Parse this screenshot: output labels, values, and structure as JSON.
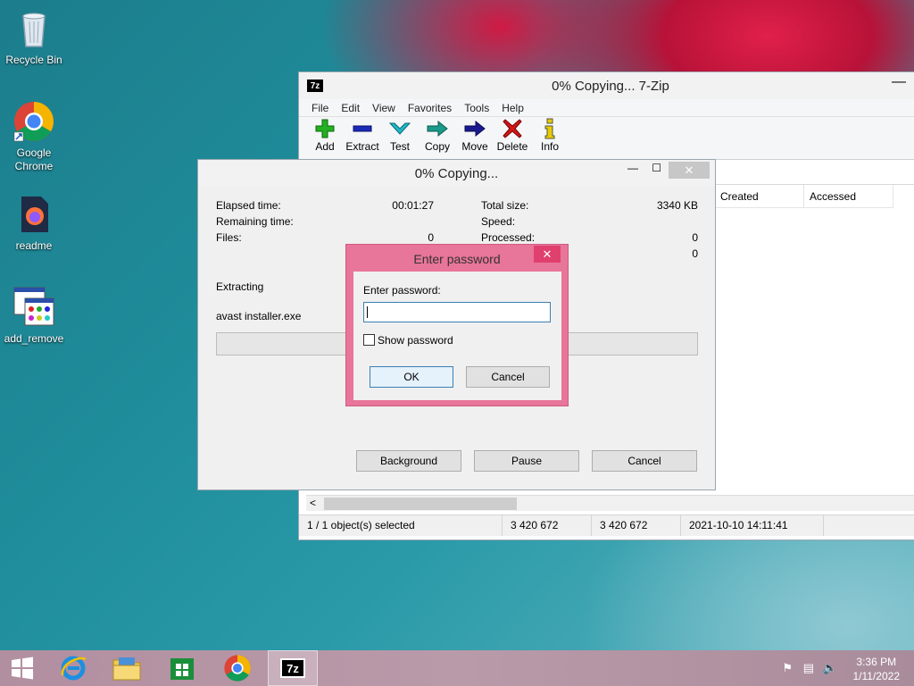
{
  "desktop": {
    "icons": [
      {
        "label": "Recycle Bin"
      },
      {
        "label": "Google Chrome"
      },
      {
        "label": "readme"
      },
      {
        "label": "add_remove"
      }
    ]
  },
  "main_window": {
    "title": "0% Copying... 7-Zip",
    "app_icon": "7z",
    "menu": [
      "File",
      "Edit",
      "View",
      "Favorites",
      "Tools",
      "Help"
    ],
    "toolbar": [
      {
        "label": "Add",
        "icon": "plus-icon",
        "color": "#22b022"
      },
      {
        "label": "Extract",
        "icon": "minus-icon",
        "color": "#1a2bb5"
      },
      {
        "label": "Test",
        "icon": "check-icon",
        "color": "#20b8c8"
      },
      {
        "label": "Copy",
        "icon": "copy-arrow-icon",
        "color": "#1a8a8a"
      },
      {
        "label": "Move",
        "icon": "move-arrow-icon",
        "color": "#1a1a90"
      },
      {
        "label": "Delete",
        "icon": "delete-x-icon",
        "color": "#d01818"
      },
      {
        "label": "Info",
        "icon": "info-icon",
        "color": "#c8b000"
      }
    ],
    "columns": [
      "Created",
      "Accessed"
    ],
    "status": [
      "1 / 1 object(s) selected",
      "3 420 672",
      "3 420 672",
      "2021-10-10 14:11:41"
    ]
  },
  "progress_dialog": {
    "title": "0% Copying...",
    "elapsed_label": "Elapsed time:",
    "elapsed_value": "00:01:27",
    "remaining_label": "Remaining time:",
    "files_label": "Files:",
    "files_value": "0",
    "total_size_label": "Total size:",
    "total_size_value": "3340 KB",
    "speed_label": "Speed:",
    "processed_label": "Processed:",
    "processed_value": "0",
    "extra_value": "0",
    "operation": "Extracting",
    "current_file": "avast installer.exe",
    "progress_fraction": 0.0,
    "buttons": {
      "background": "Background",
      "pause": "Pause",
      "cancel": "Cancel"
    }
  },
  "password_dialog": {
    "title": "Enter password",
    "prompt": "Enter password:",
    "value": "",
    "show_password_label": "Show password",
    "show_password_checked": false,
    "ok": "OK",
    "cancel": "Cancel"
  },
  "taskbar": {
    "time": "3:36 PM",
    "date": "1/11/2022"
  }
}
